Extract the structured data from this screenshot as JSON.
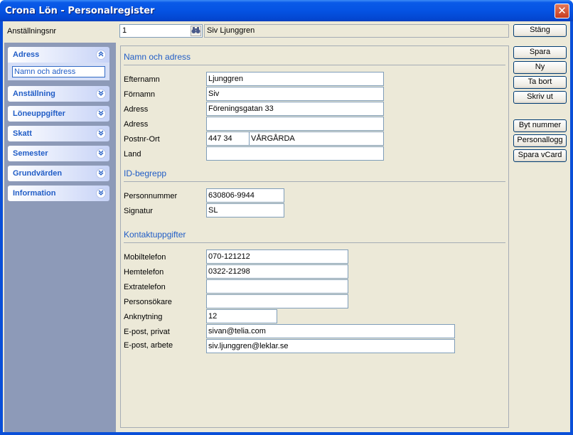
{
  "window": {
    "title": "Crona Lön - Personalregister",
    "close": "✕"
  },
  "top": {
    "employee_label": "Anställningsnr",
    "employee_number": "1",
    "employee_name": "Siv Ljunggren",
    "close_button": "Stäng"
  },
  "sidebar": {
    "groups": [
      {
        "label": "Adress",
        "expanded": true,
        "items": [
          "Namn och adress"
        ]
      },
      {
        "label": "Anställning",
        "expanded": false
      },
      {
        "label": "Löneuppgifter",
        "expanded": false
      },
      {
        "label": "Skatt",
        "expanded": false
      },
      {
        "label": "Semester",
        "expanded": false
      },
      {
        "label": "Grundvärden",
        "expanded": false
      },
      {
        "label": "Information",
        "expanded": false
      }
    ]
  },
  "actions": {
    "save": "Spara",
    "new": "Ny",
    "delete": "Ta bort",
    "print": "Skriv ut",
    "change_number": "Byt nummer",
    "staff_log": "Personallogg",
    "save_vcard": "Spara vCard"
  },
  "form": {
    "name_section": "Namn och adress",
    "labels": {
      "lastname": "Efternamn",
      "firstname": "Förnamn",
      "address1": "Adress",
      "address2": "Adress",
      "postal": "Postnr-Ort",
      "country": "Land"
    },
    "values": {
      "lastname": "Ljunggren",
      "firstname": "Siv",
      "address1": "Föreningsgatan 33",
      "address2": "",
      "postal_code": "447 34",
      "city": "VÅRGÅRDA",
      "country": ""
    },
    "id_section": "ID-begrepp",
    "id_labels": {
      "personal_number": "Personnummer",
      "signature": "Signatur"
    },
    "id_values": {
      "personal_number": "630806-9944",
      "signature": "SL"
    },
    "contact_section": "Kontaktuppgifter",
    "contact_labels": {
      "mobile": "Mobiltelefon",
      "home": "Hemtelefon",
      "extra": "Extratelefon",
      "pager": "Personsökare",
      "extension": "Anknytning",
      "email_private": "E-post, privat",
      "email_work": "E-post, arbete"
    },
    "contact_values": {
      "mobile": "070-121212",
      "home": "0322-21298",
      "extra": "",
      "pager": "",
      "extension": "12",
      "email_private": "sivan@telia.com",
      "email_work": "siv.ljunggren@leklar.se"
    }
  },
  "icons": {
    "close": "close-icon",
    "search": "binoculars-icon",
    "collapse": "chevron-up-icon",
    "expand": "chevron-down-icon"
  }
}
